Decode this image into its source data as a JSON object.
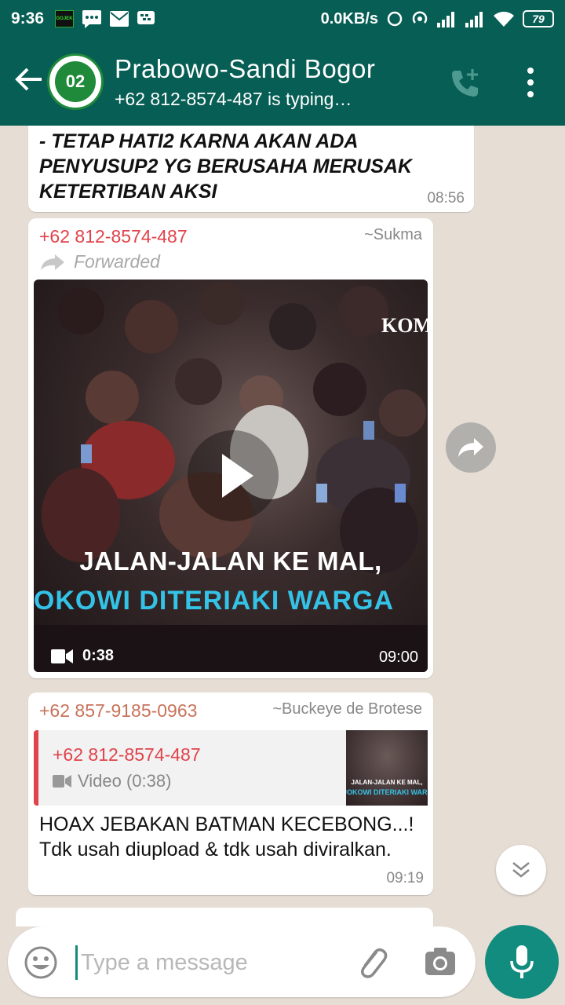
{
  "status_bar": {
    "time": "9:36",
    "gojek_label": "GOJEK",
    "network_speed": "0.0KB/s",
    "battery": "79"
  },
  "app_bar": {
    "title": "Prabowo-Sandi  Bogor",
    "subtitle": "+62 812-8574-487 is typing…",
    "avatar_text": "02"
  },
  "messages": [
    {
      "text": "- TETAP HATI2 KARNA AKAN ADA PENYUSUP2 YG BERUSAHA MERUSAK KETERTIBAN  AKSI",
      "time": "08:56"
    },
    {
      "sender": "+62 812-8574-487",
      "alias": "~Sukma",
      "forwarded_label": "Forwarded",
      "video_overlay_line1": "JALAN-JALAN KE MAL,",
      "video_overlay_line2": "JOKOWI DITERIAKI WARGA",
      "video_watermark": "KOM",
      "video_duration": "0:38",
      "time": "09:00"
    },
    {
      "sender": "+62 857-9185-0963",
      "alias": "~Buckeye de Brotese",
      "quote_sender": "+62 812-8574-487",
      "quote_type": "Video (0:38)",
      "quote_thumb_line1": "JALAN-JALAN KE MAL,",
      "quote_thumb_line2": "JOKOWI DITERIAKI WARGA",
      "text": "HOAX JEBAKAN BATMAN KECEBONG...!  Tdk usah diupload & tdk usah diviralkan.",
      "time": "09:19"
    }
  ],
  "input": {
    "placeholder": "Type a message"
  },
  "colors": {
    "header": "#075e54",
    "accent": "#128c7e",
    "sender_red": "#e0434b",
    "sender_orange": "#c8735a",
    "chat_bg": "#e6ddd4"
  }
}
